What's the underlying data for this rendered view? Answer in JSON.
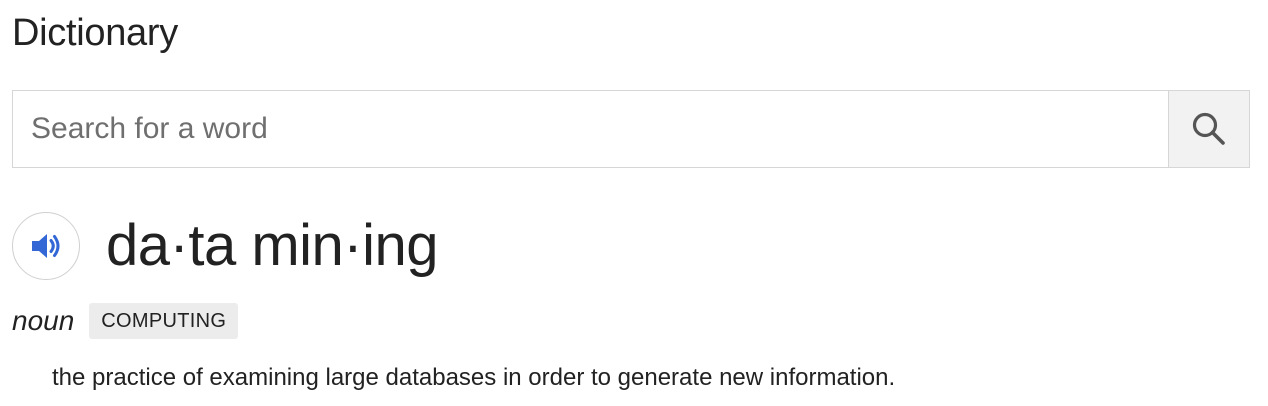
{
  "card": {
    "title": "Dictionary"
  },
  "search": {
    "placeholder": "Search for a word",
    "value": "",
    "button_icon": "search-icon"
  },
  "entry": {
    "speaker_icon": "speaker-icon",
    "headword": "da·ta min·ing",
    "part_of_speech": "noun",
    "subject_tag": "COMPUTING",
    "definition": "the practice of examining large databases in order to generate new information."
  },
  "colors": {
    "accent_blue": "#3367d6",
    "tag_background": "#ececec",
    "border": "#d6d6d6"
  }
}
